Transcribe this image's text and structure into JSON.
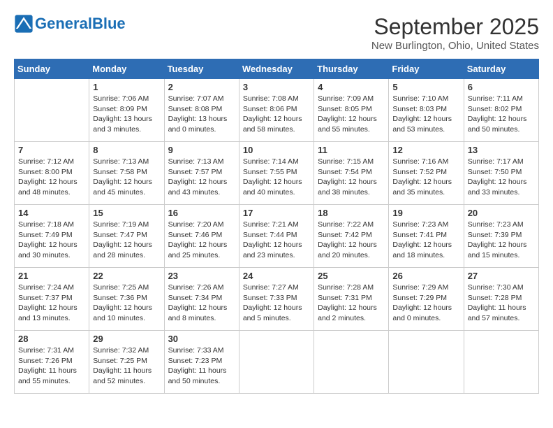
{
  "header": {
    "logo_general": "General",
    "logo_blue": "Blue",
    "month_title": "September 2025",
    "location": "New Burlington, Ohio, United States"
  },
  "days_of_week": [
    "Sunday",
    "Monday",
    "Tuesday",
    "Wednesday",
    "Thursday",
    "Friday",
    "Saturday"
  ],
  "weeks": [
    [
      {
        "day": "",
        "content": ""
      },
      {
        "day": "1",
        "content": "Sunrise: 7:06 AM\nSunset: 8:09 PM\nDaylight: 13 hours\nand 3 minutes."
      },
      {
        "day": "2",
        "content": "Sunrise: 7:07 AM\nSunset: 8:08 PM\nDaylight: 13 hours\nand 0 minutes."
      },
      {
        "day": "3",
        "content": "Sunrise: 7:08 AM\nSunset: 8:06 PM\nDaylight: 12 hours\nand 58 minutes."
      },
      {
        "day": "4",
        "content": "Sunrise: 7:09 AM\nSunset: 8:05 PM\nDaylight: 12 hours\nand 55 minutes."
      },
      {
        "day": "5",
        "content": "Sunrise: 7:10 AM\nSunset: 8:03 PM\nDaylight: 12 hours\nand 53 minutes."
      },
      {
        "day": "6",
        "content": "Sunrise: 7:11 AM\nSunset: 8:02 PM\nDaylight: 12 hours\nand 50 minutes."
      }
    ],
    [
      {
        "day": "7",
        "content": "Sunrise: 7:12 AM\nSunset: 8:00 PM\nDaylight: 12 hours\nand 48 minutes."
      },
      {
        "day": "8",
        "content": "Sunrise: 7:13 AM\nSunset: 7:58 PM\nDaylight: 12 hours\nand 45 minutes."
      },
      {
        "day": "9",
        "content": "Sunrise: 7:13 AM\nSunset: 7:57 PM\nDaylight: 12 hours\nand 43 minutes."
      },
      {
        "day": "10",
        "content": "Sunrise: 7:14 AM\nSunset: 7:55 PM\nDaylight: 12 hours\nand 40 minutes."
      },
      {
        "day": "11",
        "content": "Sunrise: 7:15 AM\nSunset: 7:54 PM\nDaylight: 12 hours\nand 38 minutes."
      },
      {
        "day": "12",
        "content": "Sunrise: 7:16 AM\nSunset: 7:52 PM\nDaylight: 12 hours\nand 35 minutes."
      },
      {
        "day": "13",
        "content": "Sunrise: 7:17 AM\nSunset: 7:50 PM\nDaylight: 12 hours\nand 33 minutes."
      }
    ],
    [
      {
        "day": "14",
        "content": "Sunrise: 7:18 AM\nSunset: 7:49 PM\nDaylight: 12 hours\nand 30 minutes."
      },
      {
        "day": "15",
        "content": "Sunrise: 7:19 AM\nSunset: 7:47 PM\nDaylight: 12 hours\nand 28 minutes."
      },
      {
        "day": "16",
        "content": "Sunrise: 7:20 AM\nSunset: 7:46 PM\nDaylight: 12 hours\nand 25 minutes."
      },
      {
        "day": "17",
        "content": "Sunrise: 7:21 AM\nSunset: 7:44 PM\nDaylight: 12 hours\nand 23 minutes."
      },
      {
        "day": "18",
        "content": "Sunrise: 7:22 AM\nSunset: 7:42 PM\nDaylight: 12 hours\nand 20 minutes."
      },
      {
        "day": "19",
        "content": "Sunrise: 7:23 AM\nSunset: 7:41 PM\nDaylight: 12 hours\nand 18 minutes."
      },
      {
        "day": "20",
        "content": "Sunrise: 7:23 AM\nSunset: 7:39 PM\nDaylight: 12 hours\nand 15 minutes."
      }
    ],
    [
      {
        "day": "21",
        "content": "Sunrise: 7:24 AM\nSunset: 7:37 PM\nDaylight: 12 hours\nand 13 minutes."
      },
      {
        "day": "22",
        "content": "Sunrise: 7:25 AM\nSunset: 7:36 PM\nDaylight: 12 hours\nand 10 minutes."
      },
      {
        "day": "23",
        "content": "Sunrise: 7:26 AM\nSunset: 7:34 PM\nDaylight: 12 hours\nand 8 minutes."
      },
      {
        "day": "24",
        "content": "Sunrise: 7:27 AM\nSunset: 7:33 PM\nDaylight: 12 hours\nand 5 minutes."
      },
      {
        "day": "25",
        "content": "Sunrise: 7:28 AM\nSunset: 7:31 PM\nDaylight: 12 hours\nand 2 minutes."
      },
      {
        "day": "26",
        "content": "Sunrise: 7:29 AM\nSunset: 7:29 PM\nDaylight: 12 hours\nand 0 minutes."
      },
      {
        "day": "27",
        "content": "Sunrise: 7:30 AM\nSunset: 7:28 PM\nDaylight: 11 hours\nand 57 minutes."
      }
    ],
    [
      {
        "day": "28",
        "content": "Sunrise: 7:31 AM\nSunset: 7:26 PM\nDaylight: 11 hours\nand 55 minutes."
      },
      {
        "day": "29",
        "content": "Sunrise: 7:32 AM\nSunset: 7:25 PM\nDaylight: 11 hours\nand 52 minutes."
      },
      {
        "day": "30",
        "content": "Sunrise: 7:33 AM\nSunset: 7:23 PM\nDaylight: 11 hours\nand 50 minutes."
      },
      {
        "day": "",
        "content": ""
      },
      {
        "day": "",
        "content": ""
      },
      {
        "day": "",
        "content": ""
      },
      {
        "day": "",
        "content": ""
      }
    ]
  ]
}
